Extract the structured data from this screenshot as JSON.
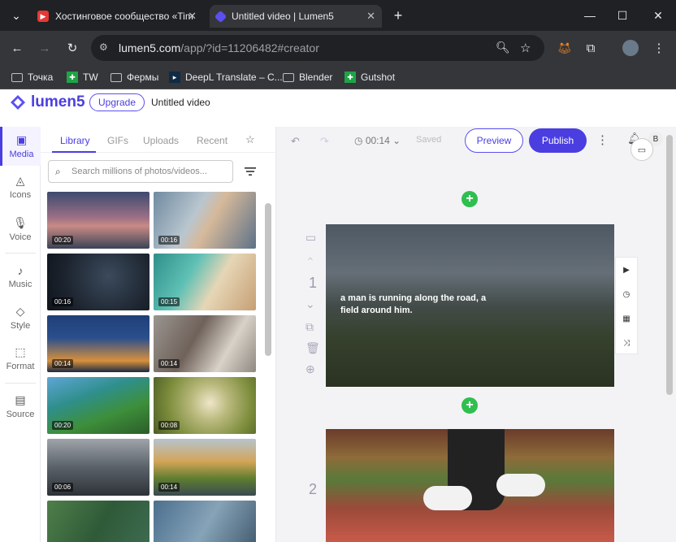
{
  "browser": {
    "tabs": [
      {
        "title": "Хостинговое сообщество «Tim",
        "favicon_color": "#e53935",
        "favicon_icon": "play-icon"
      },
      {
        "title": "Untitled video | Lumen5",
        "favicon_color": "#5b4ff0",
        "favicon_icon": "lumen5-logo-icon",
        "active": true
      }
    ],
    "new_tab": "+",
    "window_controls": [
      "minimize-icon",
      "maximize-icon",
      "close-icon"
    ],
    "url": {
      "host": "lumen5.com",
      "path": "/app/?id=11206482#creator"
    },
    "bookmarks": [
      {
        "label": "Точка",
        "icon": "folder-icon"
      },
      {
        "label": "TW",
        "icon": "green-plus-icon"
      },
      {
        "label": "Фермы",
        "icon": "folder-icon"
      },
      {
        "label": "DeepL Translate – C...",
        "icon": "deepl-icon"
      },
      {
        "label": "Blender",
        "icon": "folder-icon"
      },
      {
        "label": "Gutshot",
        "icon": "green-plus-icon"
      }
    ]
  },
  "app": {
    "brand": "lumen5",
    "upgrade_label": "Upgrade",
    "video_title": "Untitled video",
    "accent": "#4a3ee0",
    "left_nav": [
      {
        "label": "Media",
        "icon": "image-icon",
        "active": true
      },
      {
        "label": "Icons",
        "icon": "shapes-icon"
      },
      {
        "label": "Voice",
        "icon": "microphone-icon"
      },
      {
        "label": "Music",
        "icon": "music-note-icon"
      },
      {
        "label": "Style",
        "icon": "style-icon"
      },
      {
        "label": "Format",
        "icon": "format-icon"
      },
      {
        "label": "Source",
        "icon": "source-icon"
      }
    ],
    "library": {
      "tabs": [
        "Library",
        "GIFs",
        "Uploads",
        "Recent"
      ],
      "favorites_icon": "star-icon",
      "search_placeholder": "Search millions of photos/videos...",
      "items": [
        {
          "duration": "00:20",
          "subject": "sunset-sky"
        },
        {
          "duration": "00:16",
          "subject": "woman-phone"
        },
        {
          "duration": "00:16",
          "subject": "rain-drops"
        },
        {
          "duration": "00:15",
          "subject": "beach-waves"
        },
        {
          "duration": "00:14",
          "subject": "city-night"
        },
        {
          "duration": "00:14",
          "subject": "man-laptop"
        },
        {
          "duration": "00:20",
          "subject": "river-aerial"
        },
        {
          "duration": "00:08",
          "subject": "flowers"
        },
        {
          "duration": "00:06",
          "subject": "skyscrapers"
        },
        {
          "duration": "00:14",
          "subject": "construction-workers"
        },
        {
          "duration": "",
          "subject": "aerial-green"
        },
        {
          "duration": "",
          "subject": "aerial-city"
        }
      ]
    },
    "editor": {
      "duration": "00:14",
      "saved_label": "Saved",
      "preview_label": "Preview",
      "publish_label": "Publish",
      "avatar_letter": "B",
      "scenes": [
        {
          "number": "1",
          "text": "a man is running along the road, a field around him."
        },
        {
          "number": "2",
          "text": ""
        }
      ],
      "scene_tools": [
        "play-icon",
        "timer-icon",
        "layout-icon",
        "shuffle-icon"
      ]
    }
  }
}
